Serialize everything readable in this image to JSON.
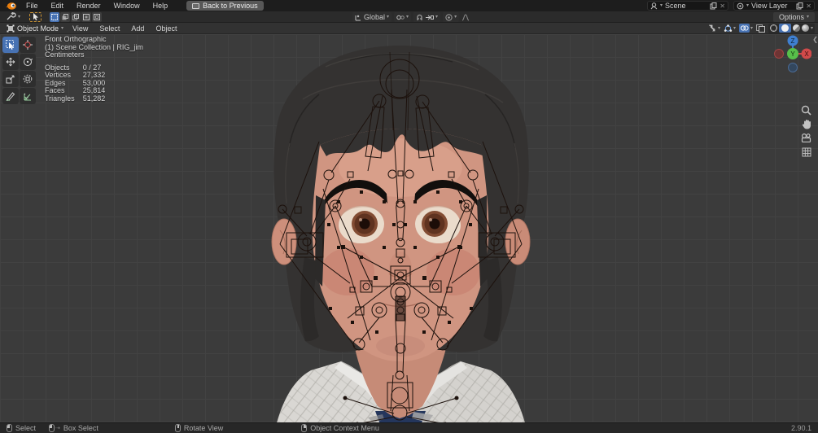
{
  "colors": {
    "accent_blue": "#4772b3",
    "topbar_bg": "#1d1d1d",
    "header_bg": "#323232",
    "viewport_bg": "#3b3b3b",
    "skin": "#d09581",
    "hair": "#343231",
    "tie_navy": "#24365c",
    "rig_wire": "#1c110c"
  },
  "topbar": {
    "menus": [
      "File",
      "Edit",
      "Render",
      "Window",
      "Help"
    ],
    "back_button": "Back to Previous",
    "scene_field": {
      "value": "Scene"
    },
    "view_layer_field": {
      "value": "View Layer"
    }
  },
  "tool_settings": {
    "orientation": "Global",
    "options_label": "Options"
  },
  "viewport_header": {
    "mode": "Object Mode",
    "menus": [
      "View",
      "Select",
      "Add",
      "Object"
    ]
  },
  "viewport_overlay": {
    "view_label": "Front Orthographic",
    "context_label": "(1) Scene Collection | RIG_jim",
    "units_label": "Centimeters",
    "stats": [
      {
        "label": "Objects",
        "value": "0 / 27"
      },
      {
        "label": "Vertices",
        "value": "27,332"
      },
      {
        "label": "Edges",
        "value": "53,000"
      },
      {
        "label": "Faces",
        "value": "25,814"
      },
      {
        "label": "Triangles",
        "value": "51,282"
      }
    ]
  },
  "gizmo": {
    "x_label": "X",
    "y_label": "Y",
    "z_label": "Z"
  },
  "statusbar": {
    "hint_select": "Select",
    "hint_box_select": "Box Select",
    "hint_rotate_view": "Rotate View",
    "hint_context_menu": "Object Context Menu",
    "version": "2.90.1"
  }
}
